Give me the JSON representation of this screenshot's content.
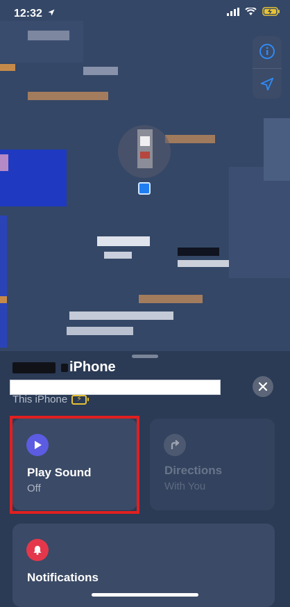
{
  "status_bar": {
    "time": "12:32",
    "icons": [
      "location-arrow-icon",
      "signal-icon",
      "wifi-icon",
      "battery-charging-icon"
    ]
  },
  "map": {
    "buttons": [
      "info-icon",
      "location-arrow-icon"
    ]
  },
  "device": {
    "name": "iPhone",
    "subtitle": "This iPhone"
  },
  "actions": {
    "play_sound": {
      "title": "Play Sound",
      "status": "Off",
      "icon": "play-icon",
      "color": "#5b5ce2"
    },
    "directions": {
      "title": "Directions",
      "subtitle": "With You",
      "icon": "turn-arrow-icon"
    },
    "notifications": {
      "title": "Notifications",
      "icon": "bell-icon",
      "color": "#e5374b"
    }
  },
  "colors": {
    "highlight": "#e02020",
    "accent": "#1f7df1"
  }
}
